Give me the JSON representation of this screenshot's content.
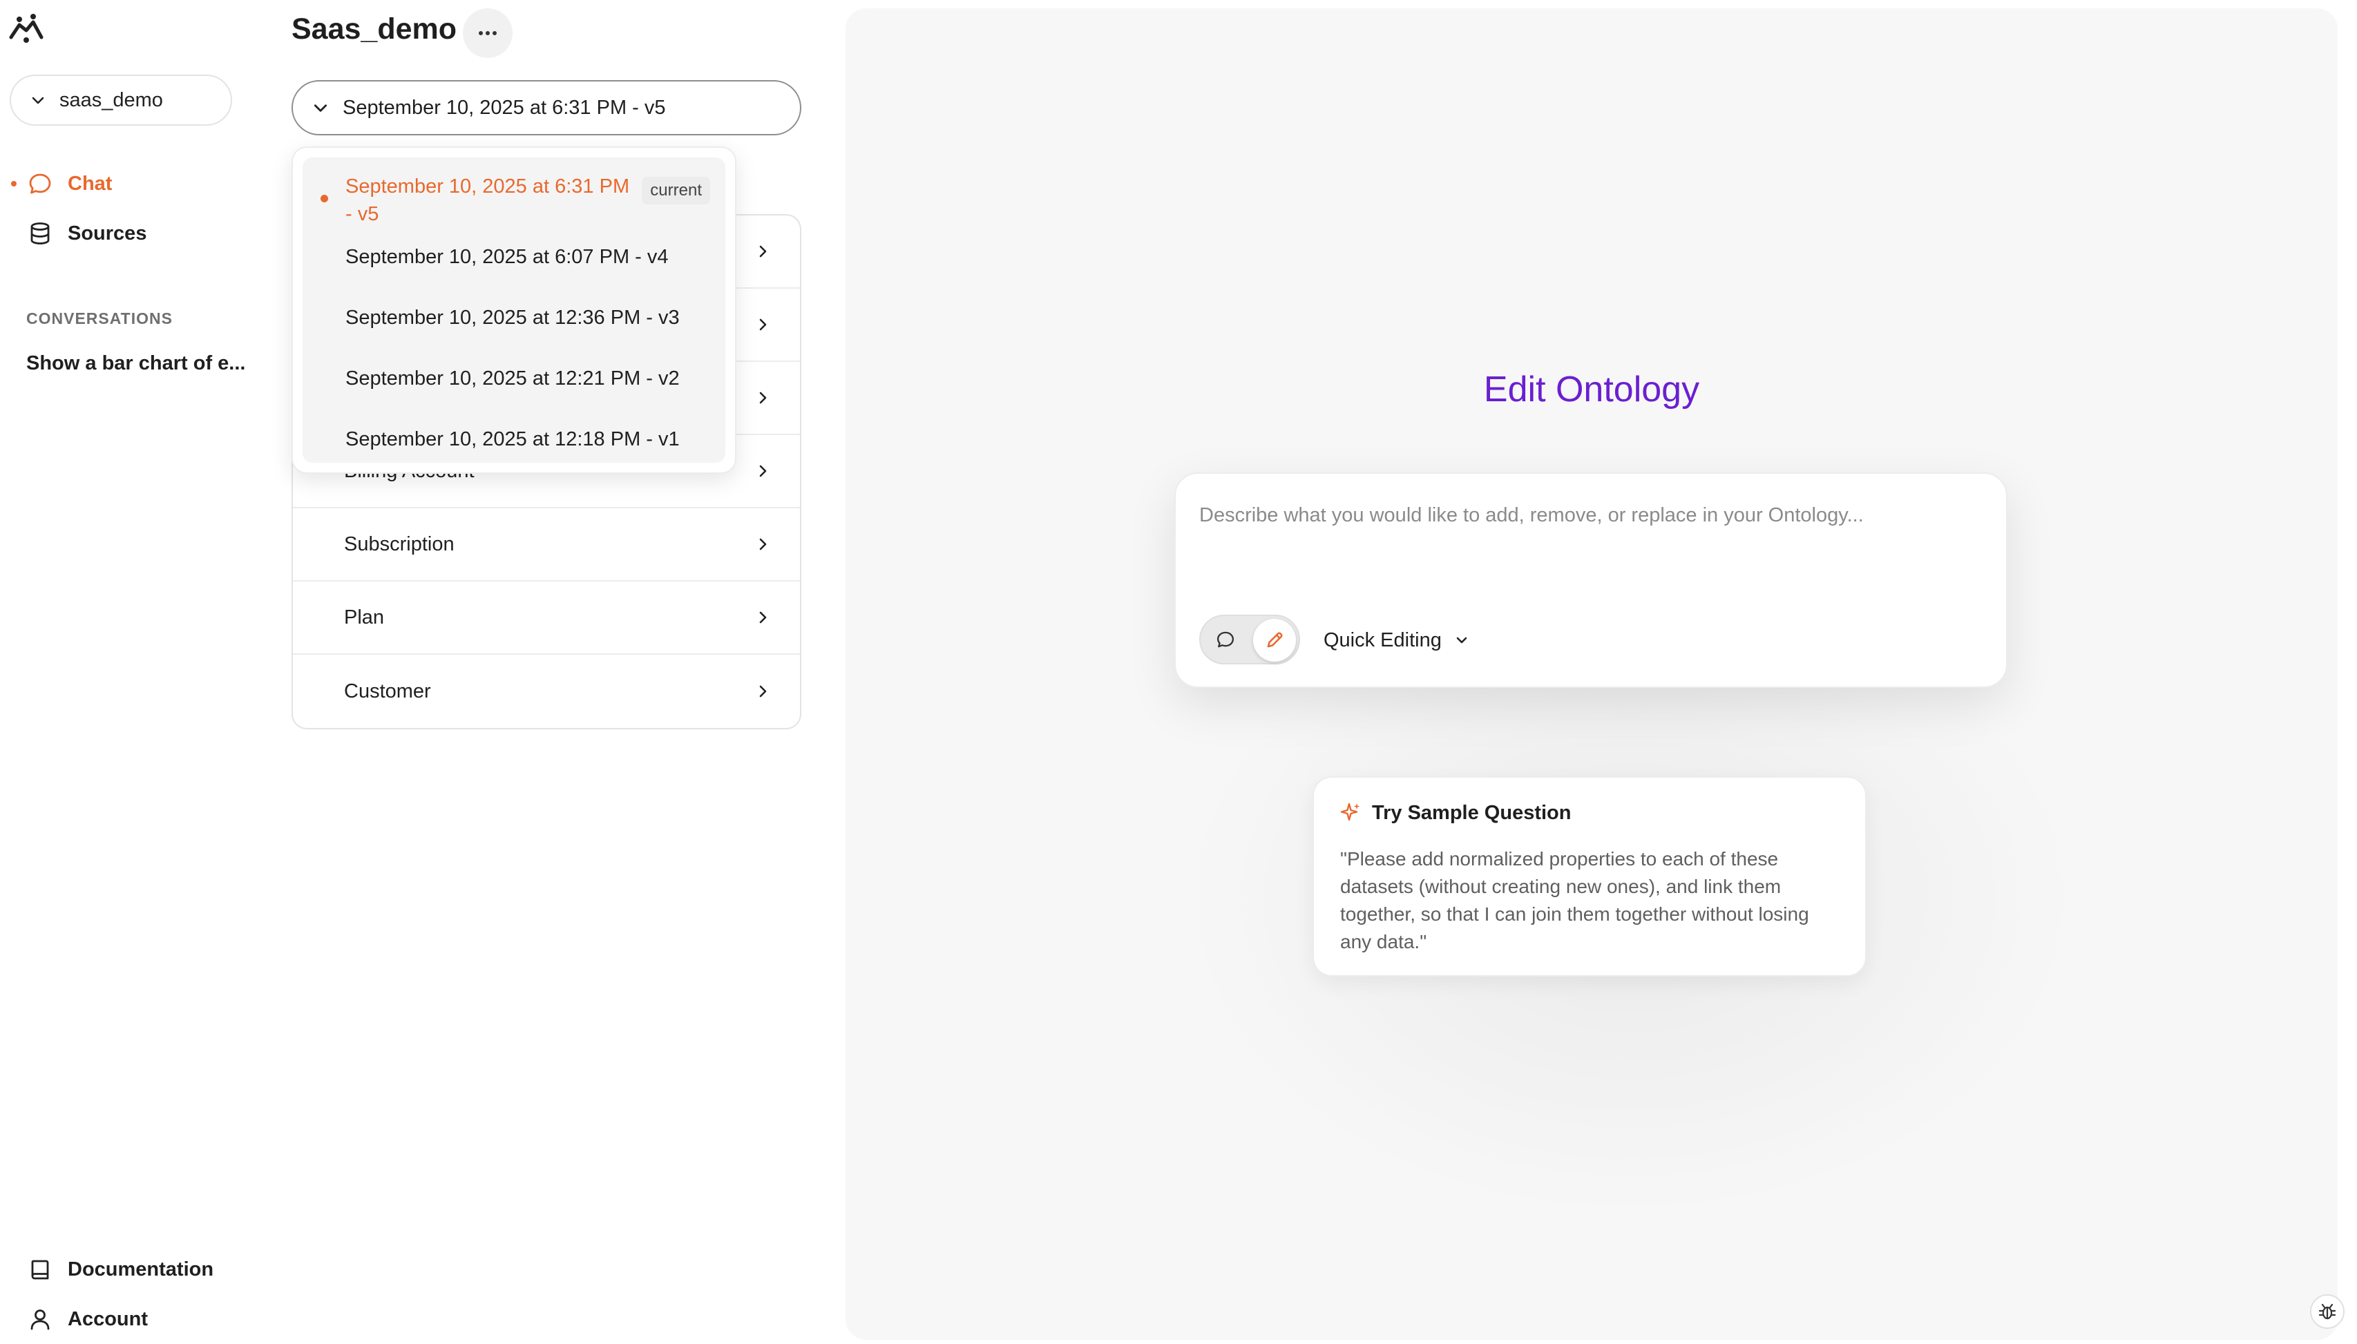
{
  "sidebar": {
    "workspace_select": "saas_demo",
    "nav": [
      {
        "label": "Chat",
        "icon": "chat-bubble-icon",
        "active": true
      },
      {
        "label": "Sources",
        "icon": "database-icon",
        "active": false
      }
    ],
    "conversations_label": "CONVERSATIONS",
    "conversations": [
      "Show a bar chart of e..."
    ],
    "footer": [
      {
        "label": "Documentation",
        "icon": "book-icon"
      },
      {
        "label": "Account",
        "icon": "user-icon"
      }
    ]
  },
  "header": {
    "title": "Saas_demo",
    "more_icon": "ellipsis-icon"
  },
  "version_select": {
    "value": "September 10, 2025 at 6:31 PM - v5"
  },
  "version_dropdown": {
    "items": [
      {
        "label": "September 10, 2025 at 6:31 PM - v5",
        "current": true
      },
      {
        "label": "September 10, 2025 at 6:07 PM - v4"
      },
      {
        "label": "September 10, 2025 at 12:36 PM - v3"
      },
      {
        "label": "September 10, 2025 at 12:21 PM - v2"
      },
      {
        "label": "September 10, 2025 at 12:18 PM - v1"
      }
    ],
    "current_badge": "current"
  },
  "entities": [
    "Billing Account",
    "Subscription",
    "Plan",
    "Customer"
  ],
  "editor": {
    "title": "Edit Ontology",
    "placeholder": "Describe what you would like to add, remove, or replace in your Ontology...",
    "mode_label": "Quick Editing"
  },
  "sample": {
    "heading": "Try Sample Question",
    "text": "\"Please add normalized properties to each of these datasets (without creating new ones), and link them together, so that I can join them together without losing any data.\""
  },
  "colors": {
    "accent": "#e8692e",
    "title_purple": "#6a1fd0"
  }
}
